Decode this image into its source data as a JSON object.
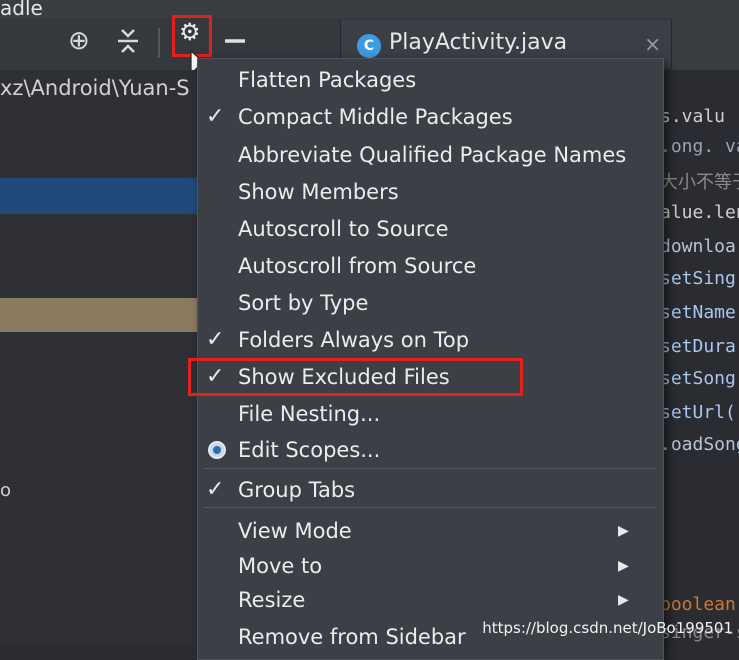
{
  "app": {
    "title_fragment": "adle"
  },
  "toolbar": {
    "locate_icon": "crosshair-icon",
    "collapse_icon": "collapse-all-icon",
    "settings_icon": "gear-icon",
    "hide_icon": "minus-icon"
  },
  "editor_tab": {
    "badge": "C",
    "label": "PlayActivity.java",
    "close": "×"
  },
  "project_panel": {
    "path": "xz\\Android\\Yuan-S",
    "fragment": "o"
  },
  "code_fragments": [
    {
      "text": "s.valu",
      "color": "#cfcfcf"
    },
    {
      "text": ".ong. va",
      "color": "#9aa4b5"
    },
    {
      "text": "大小不等于",
      "color": "#8a8a8a"
    },
    {
      "text": "alue.len",
      "color": "#cfcfcf"
    },
    {
      "text": " downloa",
      "color": "#b8c4d8"
    },
    {
      "text": " setSing",
      "color": "#a9c7ef"
    },
    {
      "text": " setName",
      "color": "#a9c7ef"
    },
    {
      "text": " setDura",
      "color": "#a9c7ef"
    },
    {
      "text": " setSong",
      "color": "#a9c7ef"
    },
    {
      "text": " setUrl(",
      "color": "#a9c7ef"
    },
    {
      "text": ".oadSong)",
      "color": "#b8c4d8"
    },
    {
      "text": "boolean i",
      "color": "#cc7832"
    },
    {
      "text": "singer-s",
      "color": "#8a8a8a"
    }
  ],
  "menu": {
    "items": [
      {
        "label": "Flatten Packages",
        "checked": false,
        "radio": false,
        "submenu": false
      },
      {
        "label": "Compact Middle Packages",
        "checked": true,
        "radio": false,
        "submenu": false
      },
      {
        "label": "Abbreviate Qualified Package Names",
        "checked": false,
        "radio": false,
        "submenu": false
      },
      {
        "label": "Show Members",
        "checked": false,
        "radio": false,
        "submenu": false
      },
      {
        "label": "Autoscroll to Source",
        "checked": false,
        "radio": false,
        "submenu": false
      },
      {
        "label": "Autoscroll from Source",
        "checked": false,
        "radio": false,
        "submenu": false
      },
      {
        "label": "Sort by Type",
        "checked": false,
        "radio": false,
        "submenu": false
      },
      {
        "label": "Folders Always on Top",
        "checked": true,
        "radio": false,
        "submenu": false
      },
      {
        "label": "Show Excluded Files",
        "checked": true,
        "radio": false,
        "submenu": false
      },
      {
        "label": "File Nesting...",
        "checked": false,
        "radio": false,
        "submenu": false
      },
      {
        "label": "Edit Scopes...",
        "checked": false,
        "radio": true,
        "submenu": false
      },
      {
        "label": "Group Tabs",
        "checked": true,
        "radio": false,
        "submenu": false
      },
      {
        "label": "View Mode",
        "checked": false,
        "radio": false,
        "submenu": true
      },
      {
        "label": "Move to",
        "checked": false,
        "radio": false,
        "submenu": true
      },
      {
        "label": "Resize",
        "checked": false,
        "radio": false,
        "submenu": true
      },
      {
        "label": "Remove from Sidebar",
        "checked": false,
        "radio": false,
        "submenu": false
      }
    ],
    "check_glyph": "✓",
    "arrow_glyph": "▶"
  },
  "highlighted_item": "Show Excluded Files",
  "watermark": "https://blog.csdn.net/JoBo199501",
  "colors": {
    "highlight_border": "#e0211d",
    "menu_bg": "#3c3f45",
    "selection": "#1f4a7a"
  }
}
